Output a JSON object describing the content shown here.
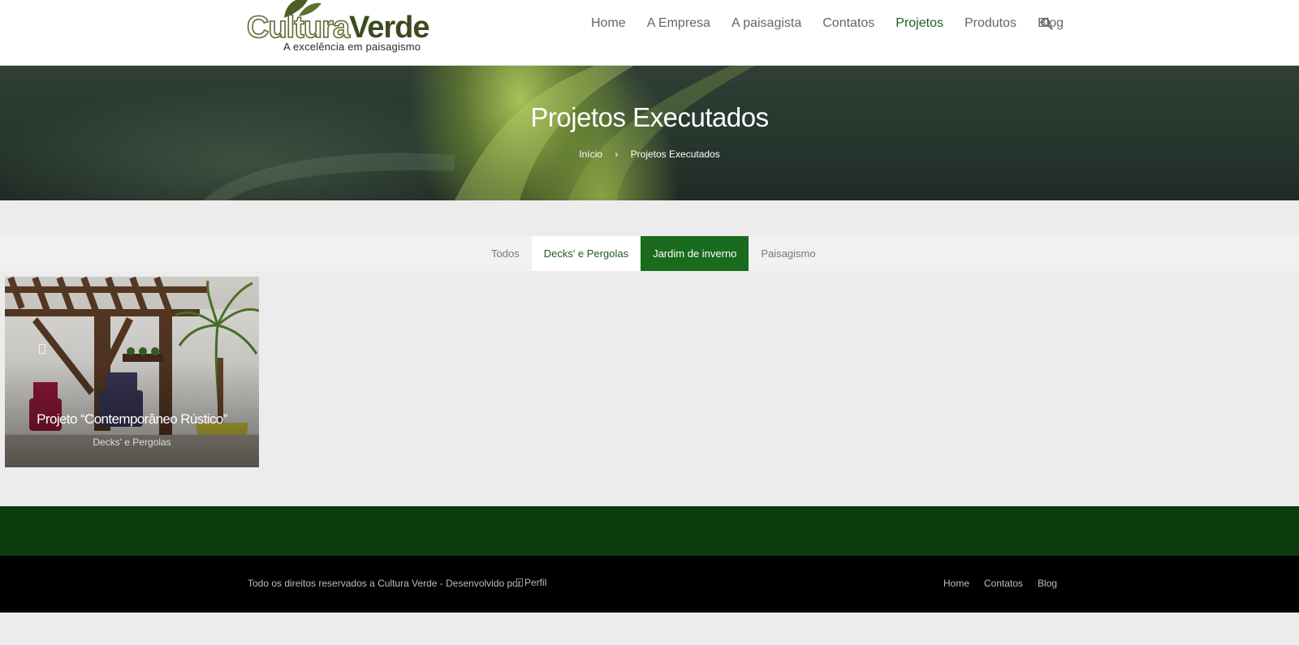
{
  "header": {
    "logo": {
      "word1": "Cultura",
      "word2": "Verde",
      "tagline": "A excelência em paisagismo"
    },
    "nav": [
      {
        "label": "Home"
      },
      {
        "label": "A Empresa"
      },
      {
        "label": "A paisagista"
      },
      {
        "label": "Contatos"
      },
      {
        "label": "Projetos",
        "active": true
      },
      {
        "label": "Produtos"
      },
      {
        "label": "Blog"
      }
    ],
    "search_icon": "search-icon"
  },
  "hero": {
    "title": "Projetos Executados",
    "breadcrumb": {
      "home": "Início",
      "separator": "›",
      "current": "Projetos Executados"
    }
  },
  "filters": {
    "items": [
      "Todos",
      "Decks' e Pergolas",
      "Jardim de inverno",
      "Paisagismo"
    ],
    "hovered": "Decks' e Pergolas",
    "selected": "Jardim de inverno"
  },
  "portfolio": {
    "items": [
      {
        "title": "Projeto “Contemporâneo Rústico”",
        "category": "Decks' e Pergolas"
      }
    ]
  },
  "footer": {
    "copyright": "Todo os direitos reservados a Cultura Verde - Desenvolvido por",
    "perfil_alt": "Perfil",
    "links": [
      "Home",
      "Contatos",
      "Blog"
    ]
  },
  "colors": {
    "brand_green": "#1b6b1f",
    "active_nav": "#1b5e20",
    "footer_green": "#0d3c0d",
    "footer_black": "#000000"
  }
}
